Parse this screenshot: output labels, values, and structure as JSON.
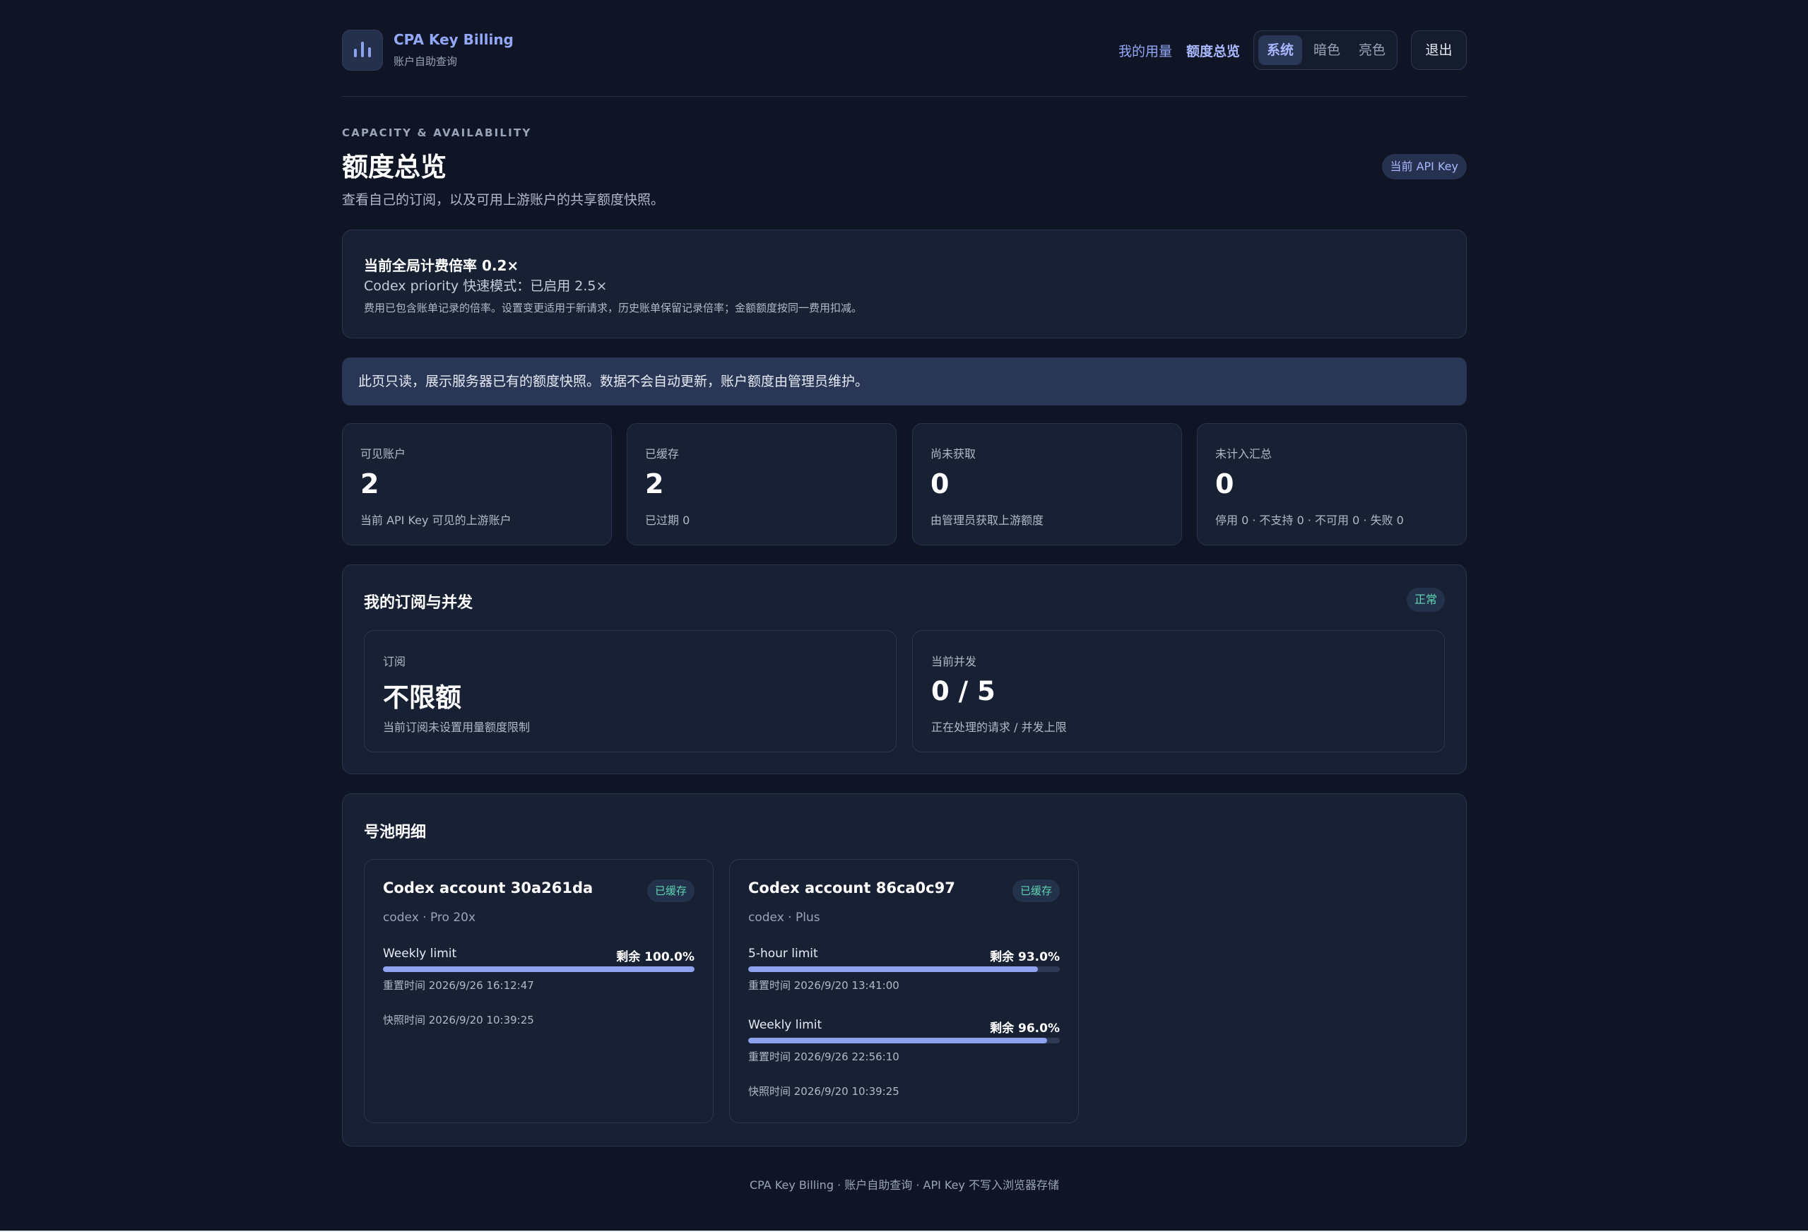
{
  "brand": {
    "title": "CPA Key Billing",
    "subtitle": "账户自助查询"
  },
  "nav": {
    "usage": "我的用量",
    "quota": "额度总览"
  },
  "theme": {
    "system": "系统",
    "dark": "暗色",
    "light": "亮色",
    "active": "system"
  },
  "logout_label": "退出",
  "page": {
    "eyebrow": "CAPACITY & AVAILABILITY",
    "title": "额度总览",
    "description": "查看自己的订阅，以及可用上游账户的共享额度快照。",
    "key_badge": "当前 API Key"
  },
  "rate": {
    "line1": "当前全局计费倍率 0.2×",
    "line2": "Codex priority 快速模式：已启用 2.5×",
    "line3": "费用已包含账单记录的倍率。设置变更适用于新请求，历史账单保留记录倍率；金额额度按同一费用扣减。"
  },
  "notice": "此页只读，展示服务器已有的额度快照。数据不会自动更新，账户额度由管理员维护。",
  "stats": [
    {
      "label": "可见账户",
      "value": "2",
      "sub": "当前 API Key 可见的上游账户"
    },
    {
      "label": "已缓存",
      "value": "2",
      "sub": "已过期 0"
    },
    {
      "label": "尚未获取",
      "value": "0",
      "sub": "由管理员获取上游额度"
    },
    {
      "label": "未计入汇总",
      "value": "0",
      "sub": "停用 0 · 不支持 0 · 不可用 0 · 失败 0"
    }
  ],
  "subscription": {
    "title": "我的订阅与并发",
    "status": "正常",
    "plan": {
      "label": "订阅",
      "value": "不限额",
      "sub": "当前订阅未设置用量额度限制"
    },
    "concurrency": {
      "label": "当前并发",
      "value": "0 / 5",
      "sub": "正在处理的请求 / 并发上限"
    }
  },
  "pool": {
    "title": "号池明细",
    "accounts": [
      {
        "name": "Codex account 30a261da",
        "badge": "已缓存",
        "plan": "codex · Pro 20x",
        "limits": [
          {
            "name": "Weekly limit",
            "remain": "剩余 100.0%",
            "percent": 100,
            "reset": "重置时间 2026/9/26 16:12:47"
          }
        ],
        "snapshot": "快照时间 2026/9/20 10:39:25"
      },
      {
        "name": "Codex account 86ca0c97",
        "badge": "已缓存",
        "plan": "codex · Plus",
        "limits": [
          {
            "name": "5-hour limit",
            "remain": "剩余 93.0%",
            "percent": 93,
            "reset": "重置时间 2026/9/20 13:41:00"
          },
          {
            "name": "Weekly limit",
            "remain": "剩余 96.0%",
            "percent": 96,
            "reset": "重置时间 2026/9/26 22:56:10"
          }
        ],
        "snapshot": "快照时间 2026/9/20 10:39:25"
      }
    ]
  },
  "footer": "CPA Key Billing · 账户自助查询 · API Key 不写入浏览器存储",
  "colors": {
    "accent": "#8ea2f0",
    "background": "#0f1524",
    "card": "#182133",
    "ok": "#5fd4b3"
  }
}
